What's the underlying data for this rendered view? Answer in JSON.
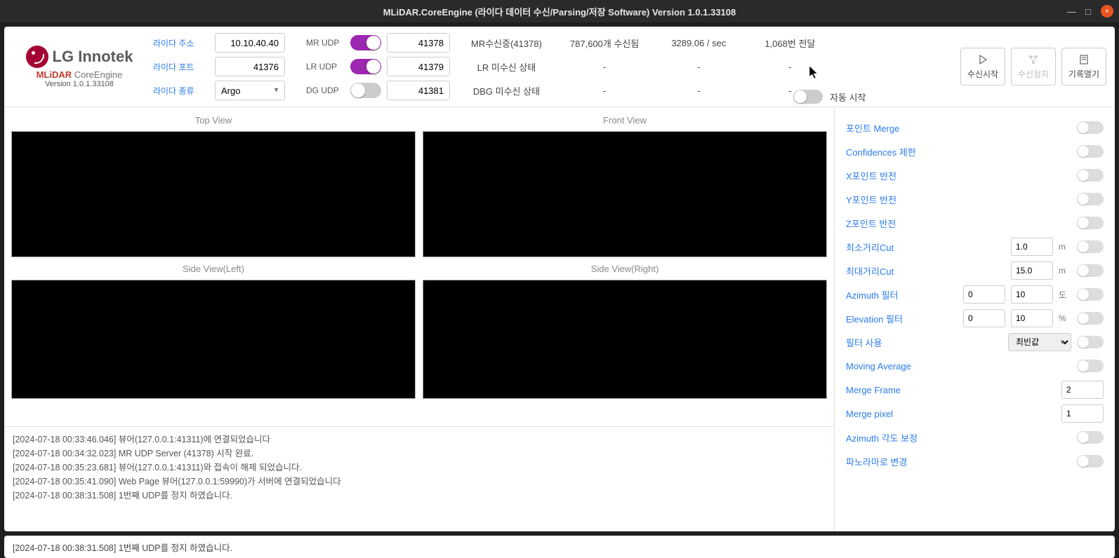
{
  "window": {
    "title": "MLiDAR.CoreEngine (라이다 데이터 수신/Parsing/저장 Software) Version 1.0.1.33108"
  },
  "logo": {
    "brand": "LG Innotek",
    "product_a": "MLiDAR",
    "product_b": " CoreEngine",
    "version": "Version 1.0.1.33108"
  },
  "config": {
    "addr_label": "라이다 주소",
    "addr_value": "10.10.40.40",
    "port_label": "라이다 포트",
    "port_value": "41376",
    "type_label": "라이다 종류",
    "type_value": "Argo"
  },
  "udp": {
    "mr_label": "MR UDP",
    "mr_port": "41378",
    "lr_label": "LR UDP",
    "lr_port": "41379",
    "dg_label": "DG UDP",
    "dg_port": "41381"
  },
  "status": {
    "r1c1": "MR수신중(41378)",
    "r2c1": "LR 미수신 상태",
    "r3c1": "DBG 미수신 상태",
    "r1c2": "787,600개 수신됨",
    "r1c3": "3289.06 / sec",
    "r1c4": "1,068번 전달",
    "dash": "-"
  },
  "buttons": {
    "start": "수신시작",
    "stop": "수신정지",
    "log": "기록열기",
    "auto": "자동 시작"
  },
  "views": {
    "top": "Top View",
    "front": "Front View",
    "left": "Side View(Left)",
    "right": "Side View(Right)"
  },
  "side": {
    "point_merge": "포인트 Merge",
    "conf_limit": "Confidences 제한",
    "x_invert": "X포인트 반전",
    "y_invert": "Y포인트 반전",
    "z_invert": "Z포인트 반전",
    "min_cut": "최소거리Cut",
    "min_cut_val": "1.0",
    "max_cut": "최대거리Cut",
    "max_cut_val": "15.0",
    "unit_m": "m",
    "azimuth": "Azimuth 필터",
    "az_v1": "0",
    "az_v2": "10",
    "unit_deg": "도",
    "elevation": "Elevation 필터",
    "el_v1": "0",
    "el_v2": "10",
    "unit_pct": "%",
    "filter_use": "필터 사용",
    "filter_val": "최빈값",
    "moving_avg": "Moving Average",
    "merge_frame": "Merge Frame",
    "merge_frame_val": "2",
    "merge_pixel": "Merge pixel",
    "merge_pixel_val": "1",
    "az_angle": "Azimuth 각도 보정",
    "panorama": "파노라마로 변경"
  },
  "logs": [
    "[2024-07-18 00:33:46.046] 뷰어(127.0.0.1:41311)에 연결되었습니다",
    "[2024-07-18 00:34:32.023] MR UDP Server (41378)  시작 완료.",
    "[2024-07-18 00:35:23.681] 뷰어(127.0.0.1:41311)와 접속이 해제 되었습니다.",
    "[2024-07-18 00:35:41.090] Web Page 뷰어(127.0.0.1:59990)가 서버에 연결되었습니다",
    "[2024-07-18 00:38:31.508] 1번째 UDP를 정지 하였습니다."
  ],
  "statusbar": "[2024-07-18 00:38:31.508] 1번째 UDP를 정지 하였습니다."
}
